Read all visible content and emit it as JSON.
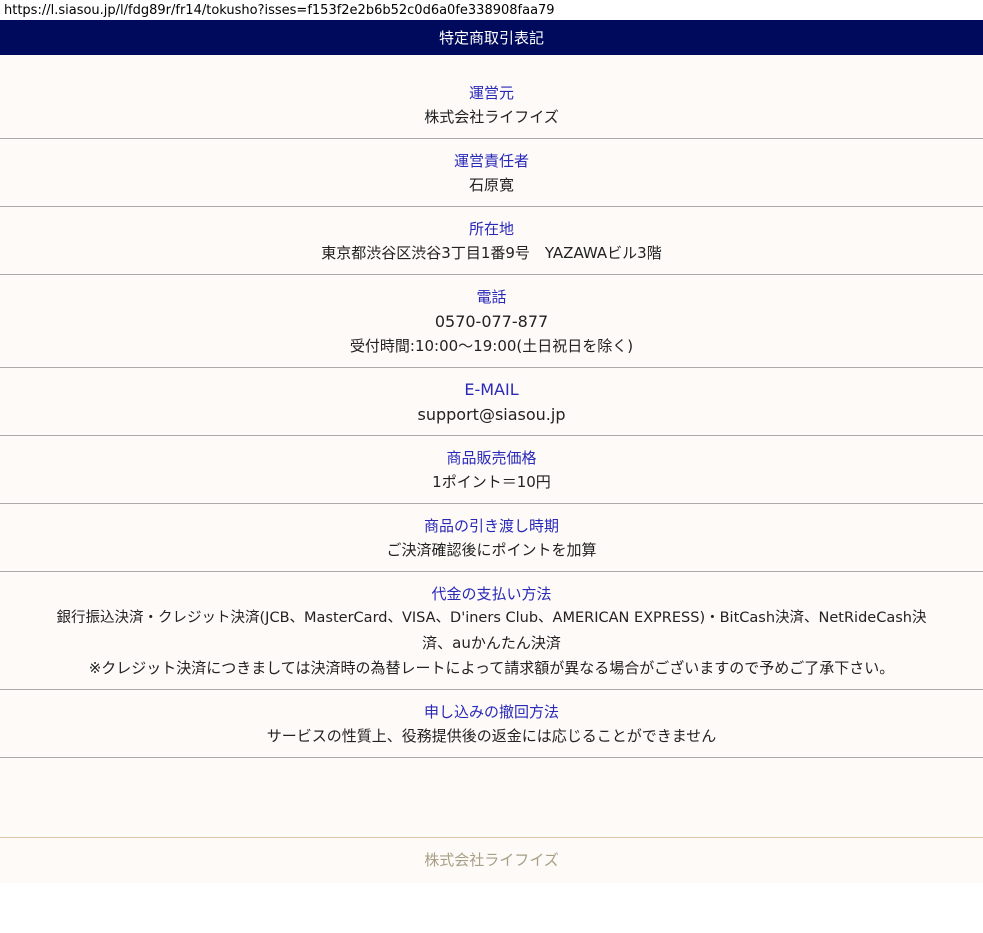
{
  "browser": {
    "url": "https://l.siasou.jp/l/fdg89r/fr14/tokusho?isses=f153f2e2b6b52c0d6a0fe338908faa79"
  },
  "header": {
    "title": "特定商取引表記"
  },
  "sections": [
    {
      "label": "運営元",
      "values": [
        "株式会社ライフイズ"
      ]
    },
    {
      "label": "運営責任者",
      "values": [
        "石原寛"
      ]
    },
    {
      "label": "所在地",
      "values": [
        "東京都渋谷区渋谷3丁目1番9号　YAZAWAビル3階"
      ]
    },
    {
      "label": "電話",
      "values": [
        "0570-077-877",
        "受付時間:10:00～19:00(土日祝日を除く)"
      ]
    },
    {
      "label": "E-MAIL",
      "values": [
        "support@siasou.jp"
      ]
    },
    {
      "label": "商品販売価格",
      "values": [
        "1ポイント＝10円"
      ]
    },
    {
      "label": "商品の引き渡し時期",
      "values": [
        "ご決済確認後にポイントを加算"
      ]
    },
    {
      "label": "代金の支払い方法",
      "values": [
        "銀行振込決済・クレジット決済(JCB、MasterCard、VISA、D'iners Club、AMERICAN EXPRESS)・BitCash決済、NetRideCash決",
        "済、auかんたん決済",
        "※クレジット決済につきましては決済時の為替レートによって請求額が異なる場合がございますので予めご了承下さい。"
      ]
    },
    {
      "label": "申し込みの撤回方法",
      "values": [
        "サービスの性質上、役務提供後の返金には応じることができません"
      ]
    }
  ],
  "footer": {
    "company": "株式会社ライフイズ"
  }
}
